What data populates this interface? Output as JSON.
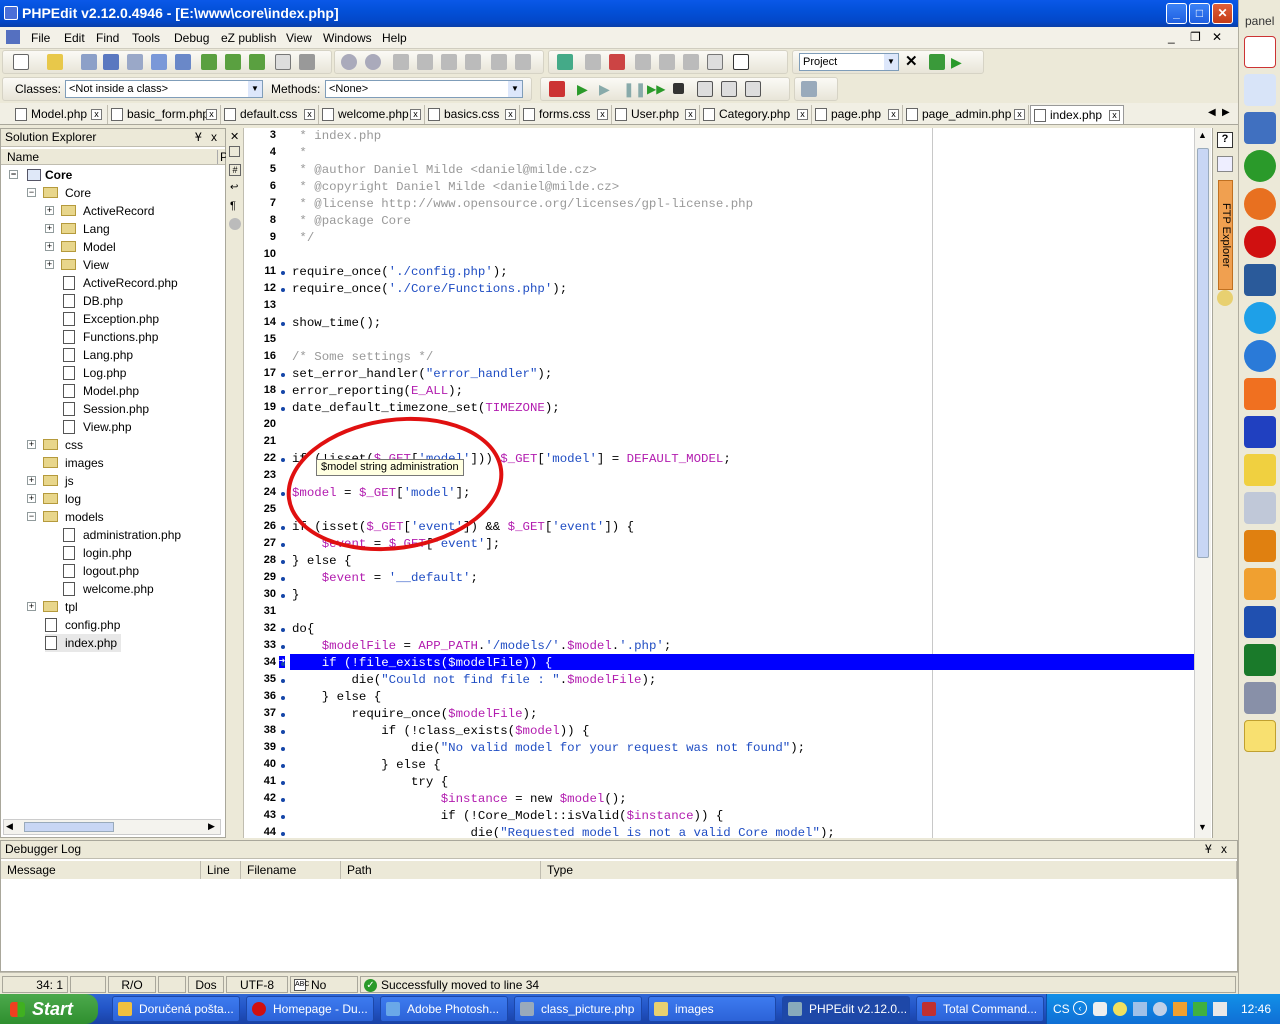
{
  "window": {
    "title": "PHPEdit v2.12.0.4946 - [E:\\www\\core\\index.php]",
    "min": "_",
    "max": "□",
    "close": "✕",
    "mdi_min": "_",
    "mdi_restore": "❐",
    "mdi_close": "✕"
  },
  "menu": [
    "File",
    "Edit",
    "Find",
    "Tools",
    "Debug",
    "eZ publish",
    "View",
    "Windows",
    "Help"
  ],
  "toolbar": {
    "project_combo": "Project",
    "classes_label": "Classes:",
    "classes_value": "<Not inside a class>",
    "methods_label": "Methods:",
    "methods_value": "<None>"
  },
  "tabs": [
    {
      "label": "Model.php"
    },
    {
      "label": "basic_form.php"
    },
    {
      "label": "default.css"
    },
    {
      "label": "welcome.php"
    },
    {
      "label": "basics.css"
    },
    {
      "label": "forms.css"
    },
    {
      "label": "User.php"
    },
    {
      "label": "Category.php"
    },
    {
      "label": "page.php"
    },
    {
      "label": "page_admin.php"
    },
    {
      "label": "index.php"
    }
  ],
  "tab_close": "x",
  "solution": {
    "title": "Solution Explorer",
    "col_name": "Name",
    "col_p": "P",
    "pin": "Ұ",
    "close": "x",
    "tree": [
      "Core",
      "Core",
      "ActiveRecord",
      "Lang",
      "Model",
      "View",
      "ActiveRecord.php",
      "DB.php",
      "Exception.php",
      "Functions.php",
      "Lang.php",
      "Log.php",
      "Model.php",
      "Session.php",
      "View.php",
      "css",
      "images",
      "js",
      "log",
      "models",
      "administration.php",
      "login.php",
      "logout.php",
      "welcome.php",
      "tpl",
      "config.php",
      "index.php"
    ]
  },
  "editor": {
    "line_numbers": [
      "3",
      "4",
      "5",
      "6",
      "7",
      "8",
      "9",
      "10",
      "11",
      "12",
      "13",
      "14",
      "15",
      "16",
      "17",
      "18",
      "19",
      "20",
      "21",
      "22",
      "23",
      "24",
      "25",
      "26",
      "27",
      "28",
      "29",
      "30",
      "31",
      "32",
      "33",
      "34",
      "35",
      "36",
      "37",
      "38",
      "39",
      "40",
      "41",
      "42",
      "43",
      "44"
    ],
    "lines": [
      " * index.php",
      " *",
      " * @author Daniel Milde <daniel@milde.cz>",
      " * @copyright Daniel Milde <daniel@milde.cz>",
      " * @license http://www.opensource.org/licenses/gpl-license.php",
      " * @package Core",
      " */",
      "",
      "require_once('./config.php');",
      "require_once('./Core/Functions.php');",
      "",
      "show_time();",
      "",
      "/* Some settings */",
      "set_error_handler(\"error_handler\");",
      "error_reporting(E_ALL);",
      "date_default_timezone_set(TIMEZONE);",
      "",
      "",
      "if (!isset($_GET['model'])) $_GET['model'] = DEFAULT_MODEL;",
      "",
      "$model = $_GET['model'];",
      "",
      "if (isset($_GET['event']) && $_GET['event']) {",
      "    $event = $_GET['event'];",
      "} else {",
      "    $event = '__default';",
      "}",
      "",
      "do{",
      "    $modelFile = APP_PATH.'/models/'.$model.'.php';",
      "    if (!file_exists($modelFile)) {",
      "        die(\"Could not find file : \".$modelFile);",
      "    } else {",
      "        require_once($modelFile);",
      "            if (!class_exists($model)) {",
      "                die(\"No valid model for your request was not found\");",
      "            } else {",
      "                try {",
      "                    $instance = new $model();",
      "                    if (!Core_Model::isValid($instance)) {",
      "                        die(\"Requested model is not a valid Core model\");"
    ],
    "tooltip": "$model  string  administration"
  },
  "ftp_explorer": "FTP Explorer",
  "debugger": {
    "title": "Debugger Log",
    "columns": [
      "Message",
      "Line",
      "Filename",
      "Path",
      "Type"
    ],
    "pin": "Ұ",
    "close": "x"
  },
  "status": {
    "position": "34:  1",
    "ro": "R/O",
    "eol": "Dos",
    "enc": "UTF-8",
    "errors": "No errors",
    "message": "Successfully moved to line 34"
  },
  "taskbar": {
    "start": "Start",
    "tasks": [
      "Doručená pošta...",
      "Homepage - Du...",
      "Adobe Photosh...",
      "class_picture.php",
      "images",
      "PHPEdit v2.12.0...",
      "Total Command..."
    ],
    "lang": "CS",
    "clock": "12:46"
  },
  "sidepanel": {
    "label": "panel"
  },
  "colors": {
    "highlight": "#0000ff",
    "comment": "#999999",
    "string": "#1f4dc3",
    "variable": "#b21caf",
    "annotation": "#e01010"
  }
}
